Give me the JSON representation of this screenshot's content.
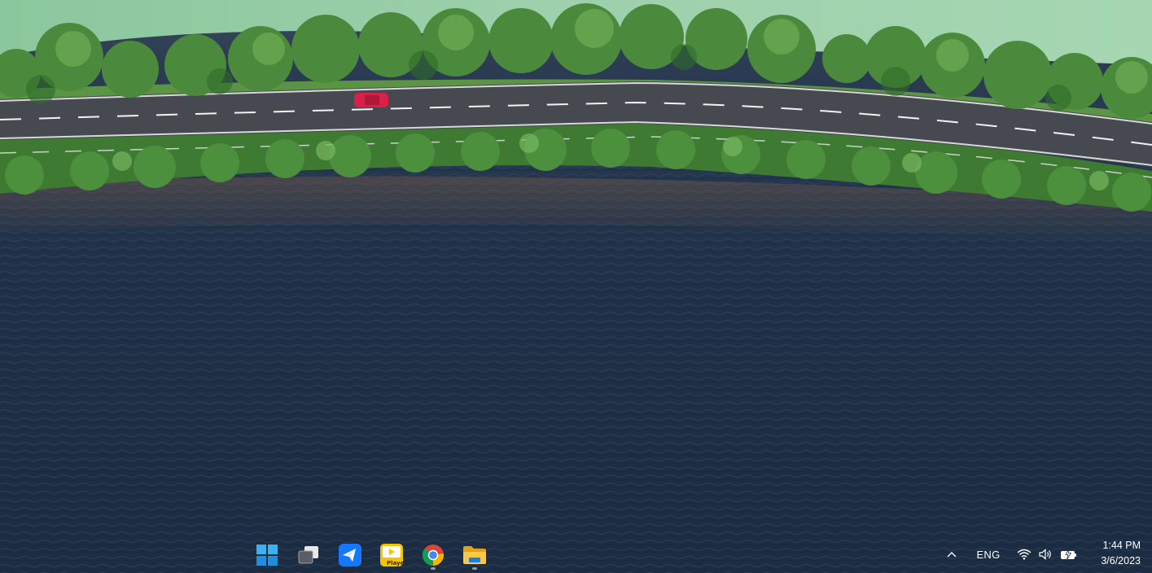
{
  "wallpaper": {
    "description_colors": {
      "sea": "#1f3148",
      "foliage": "#4b8a3c",
      "road": "#4a4d52",
      "car": "#d8204a",
      "green_water": "#8fc8a0"
    }
  },
  "taskbar": {
    "pinned": [
      {
        "id": "start",
        "icon": "windows-logo-icon",
        "running": false
      },
      {
        "id": "task-view",
        "icon": "task-view-icon",
        "running": false
      },
      {
        "id": "feishu",
        "icon": "bird-app-icon",
        "running": false
      },
      {
        "id": "potplayer",
        "icon": "player-app-icon",
        "label": "Player",
        "running": false
      },
      {
        "id": "chrome",
        "icon": "chrome-icon",
        "running": true
      },
      {
        "id": "file-explorer",
        "icon": "folder-icon",
        "running": true
      }
    ],
    "tray": {
      "overflow_icon": "chevron-up-icon",
      "language": "ENG",
      "network_icon": "wifi-icon",
      "volume_icon": "speaker-icon",
      "battery_icon": "battery-charging-icon"
    },
    "clock": {
      "time": "1:44 PM",
      "date": "3/6/2023"
    }
  },
  "colors": {
    "accent": "#0078d4",
    "potplayer": "#f5c400",
    "bird_app": "#1677ff",
    "folder": "#f2b81f"
  }
}
